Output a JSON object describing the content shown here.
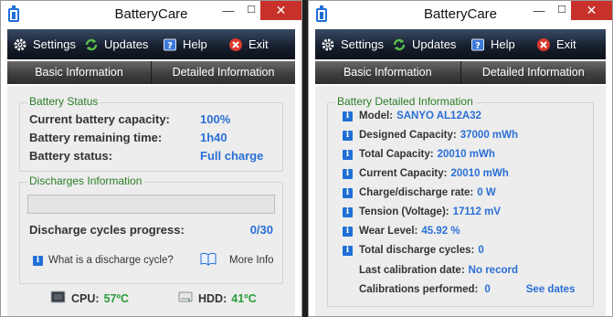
{
  "app": {
    "title": "BatteryCare"
  },
  "window_controls": {
    "minimize": "—",
    "maximize": "☐",
    "close": "✕"
  },
  "menu": {
    "settings": "Settings",
    "updates": "Updates",
    "help": "Help",
    "exit": "Exit"
  },
  "tabs": {
    "basic": "Basic Information",
    "detailed": "Detailed Information"
  },
  "battery_status": {
    "title": "Battery Status",
    "capacity_label": "Current battery capacity:",
    "capacity_value": "100%",
    "remaining_label": "Battery remaining time:",
    "remaining_value": "1h40",
    "status_label": "Battery status:",
    "status_value": "Full charge"
  },
  "discharges": {
    "title": "Discharges Information",
    "progress_label": "Discharge cycles progress:",
    "progress_value": "0/30",
    "progress_fraction": 0,
    "what_is_link": "What is a discharge cycle?",
    "more_info": "More Info"
  },
  "temps": {
    "cpu_label": "CPU:",
    "cpu_value": "57ºC",
    "hdd_label": "HDD:",
    "hdd_value": "41ºC"
  },
  "detailed": {
    "title": "Battery Detailed Information",
    "model_label": "Model:",
    "model_value": "SANYO AL12A32",
    "designed_label": "Designed Capacity:",
    "designed_value": "37000 mWh",
    "total_label": "Total Capacity:",
    "total_value": "20010 mWh",
    "current_label": "Current Capacity:",
    "current_value": "20010 mWh",
    "rate_label": "Charge/discharge rate:",
    "rate_value": "0 W",
    "tension_label": "Tension (Voltage):",
    "tension_value": "17112 mV",
    "wear_label": "Wear Level:",
    "wear_value": "45.92 %",
    "cycles_label": "Total discharge cycles:",
    "cycles_value": "0",
    "calib_date_label": "Last calibration date:",
    "calib_date_value": "No record",
    "calib_perf_label": "Calibrations performed:",
    "calib_perf_value": "0",
    "see_dates": "See dates"
  },
  "colors": {
    "accent": "#2a6fd6",
    "legend": "#2a7e26",
    "close": "#c7312a",
    "menubar": "#17202f"
  }
}
